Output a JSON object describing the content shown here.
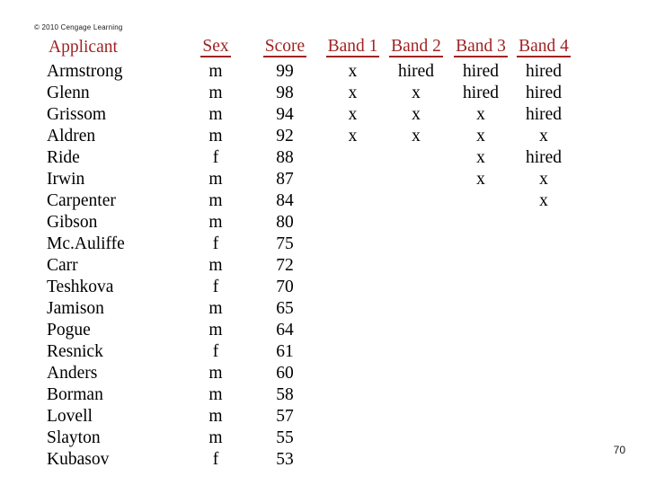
{
  "slide": {
    "copyright": "© 2010 Cengage Learning",
    "page_number": "70",
    "header_color": "#A02323",
    "body_color": "#000000",
    "background_color": "#FFFFFF"
  },
  "table": {
    "columns": [
      {
        "key": "applicant",
        "label": "Applicant",
        "underlined": false,
        "align": "left"
      },
      {
        "key": "sex",
        "label": "Sex",
        "underlined": true,
        "align": "center"
      },
      {
        "key": "score",
        "label": "Score",
        "underlined": true,
        "align": "center"
      },
      {
        "key": "band1",
        "label": "Band 1",
        "underlined": true,
        "align": "center"
      },
      {
        "key": "band2",
        "label": "Band 2",
        "underlined": true,
        "align": "center"
      },
      {
        "key": "band3",
        "label": "Band 3",
        "underlined": true,
        "align": "center"
      },
      {
        "key": "band4",
        "label": "Band 4",
        "underlined": true,
        "align": "center"
      }
    ],
    "rows": [
      {
        "applicant": "Armstrong",
        "sex": "m",
        "score": "99",
        "band1": "x",
        "band2": "hired",
        "band3": "hired",
        "band4": "hired"
      },
      {
        "applicant": "Glenn",
        "sex": "m",
        "score": "98",
        "band1": "x",
        "band2": "x",
        "band3": "hired",
        "band4": "hired"
      },
      {
        "applicant": "Grissom",
        "sex": "m",
        "score": "94",
        "band1": "x",
        "band2": "x",
        "band3": "x",
        "band4": "hired"
      },
      {
        "applicant": "Aldren",
        "sex": "m",
        "score": "92",
        "band1": "x",
        "band2": "x",
        "band3": "x",
        "band4": "x"
      },
      {
        "applicant": "Ride",
        "sex": "f",
        "score": "88",
        "band1": "",
        "band2": "",
        "band3": "x",
        "band4": "hired"
      },
      {
        "applicant": "Irwin",
        "sex": "m",
        "score": "87",
        "band1": "",
        "band2": "",
        "band3": "x",
        "band4": "x"
      },
      {
        "applicant": "Carpenter",
        "sex": "m",
        "score": "84",
        "band1": "",
        "band2": "",
        "band3": "",
        "band4": "x"
      },
      {
        "applicant": "Gibson",
        "sex": "m",
        "score": "80",
        "band1": "",
        "band2": "",
        "band3": "",
        "band4": ""
      },
      {
        "applicant": "Mc.Auliffe",
        "sex": "f",
        "score": "75",
        "band1": "",
        "band2": "",
        "band3": "",
        "band4": ""
      },
      {
        "applicant": "Carr",
        "sex": "m",
        "score": "72",
        "band1": "",
        "band2": "",
        "band3": "",
        "band4": ""
      },
      {
        "applicant": "Teshkova",
        "sex": "f",
        "score": "70",
        "band1": "",
        "band2": "",
        "band3": "",
        "band4": ""
      },
      {
        "applicant": "Jamison",
        "sex": "m",
        "score": "65",
        "band1": "",
        "band2": "",
        "band3": "",
        "band4": ""
      },
      {
        "applicant": "Pogue",
        "sex": "m",
        "score": "64",
        "band1": "",
        "band2": "",
        "band3": "",
        "band4": ""
      },
      {
        "applicant": "Resnick",
        "sex": "f",
        "score": "61",
        "band1": "",
        "band2": "",
        "band3": "",
        "band4": ""
      },
      {
        "applicant": "Anders",
        "sex": "m",
        "score": "60",
        "band1": "",
        "band2": "",
        "band3": "",
        "band4": ""
      },
      {
        "applicant": "Borman",
        "sex": "m",
        "score": "58",
        "band1": "",
        "band2": "",
        "band3": "",
        "band4": ""
      },
      {
        "applicant": "Lovell",
        "sex": "m",
        "score": "57",
        "band1": "",
        "band2": "",
        "band3": "",
        "band4": ""
      },
      {
        "applicant": "Slayton",
        "sex": "m",
        "score": "55",
        "band1": "",
        "band2": "",
        "band3": "",
        "band4": ""
      },
      {
        "applicant": "Kubasov",
        "sex": "f",
        "score": "53",
        "band1": "",
        "band2": "",
        "band3": "",
        "band4": ""
      }
    ]
  }
}
